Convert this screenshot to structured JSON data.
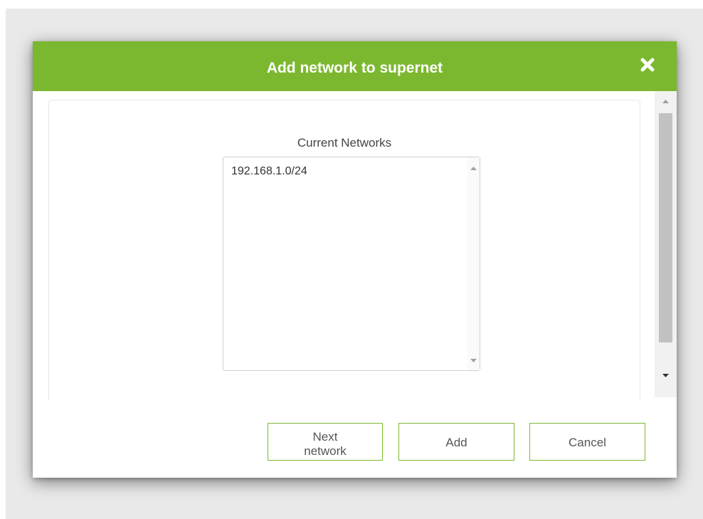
{
  "dialog": {
    "title": "Add network to supernet",
    "close_icon": "close-icon"
  },
  "networks": {
    "label": "Current Networks",
    "items": [
      "192.168.1.0/24"
    ]
  },
  "buttons": {
    "next_line1": "Next",
    "next_line2": "network",
    "add": "Add",
    "cancel": "Cancel"
  },
  "colors": {
    "accent": "#7cb82f"
  }
}
